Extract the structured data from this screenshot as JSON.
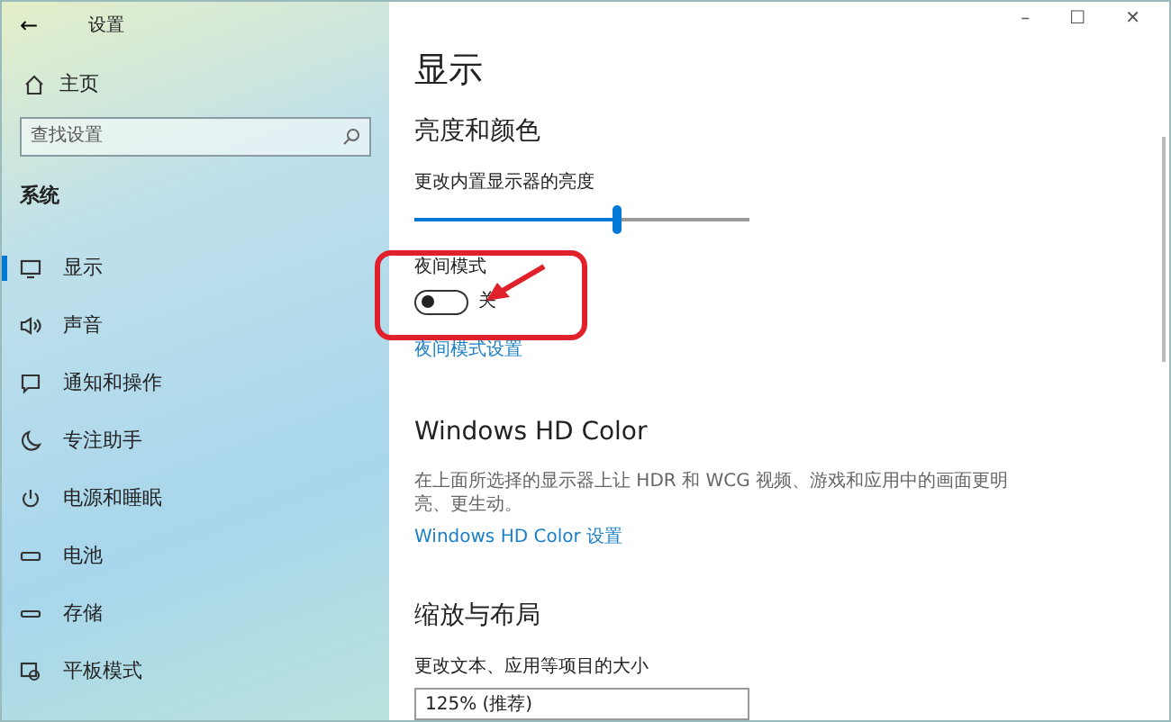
{
  "window": {
    "title": "设置",
    "controls": [
      "–",
      "☐",
      "✕"
    ],
    "back": "←"
  },
  "sidebar": {
    "home": "主页",
    "search": {
      "placeholder": "查找设置"
    },
    "section": "系统",
    "items": [
      {
        "label": "显示",
        "selected": true
      },
      {
        "label": "声音",
        "selected": false
      },
      {
        "label": "通知和操作",
        "selected": false
      },
      {
        "label": "专注助手",
        "selected": false
      },
      {
        "label": "电源和睡眠",
        "selected": false
      },
      {
        "label": "电池",
        "selected": false
      },
      {
        "label": "存储",
        "selected": false
      },
      {
        "label": "平板模式",
        "selected": false
      }
    ]
  },
  "content": {
    "title": "显示",
    "brightness": {
      "heading": "亮度和颜色",
      "label": "更改内置显示器的亮度",
      "level": 0.6
    },
    "night_mode": {
      "label": "夜间模式",
      "on": false,
      "state": "关",
      "link": "夜间模式设置"
    },
    "hd_color": {
      "heading": "Windows HD Color",
      "description": "在上面所选择的显示器上让 HDR 和 WCG 视频、游戏和应用中的画面更明亮、更生动。",
      "link": "Windows HD Color 设置"
    },
    "scale": {
      "heading": "缩放与布局",
      "label": "更改文本、应用等项目的大小",
      "value": "125% (推荐)"
    }
  }
}
